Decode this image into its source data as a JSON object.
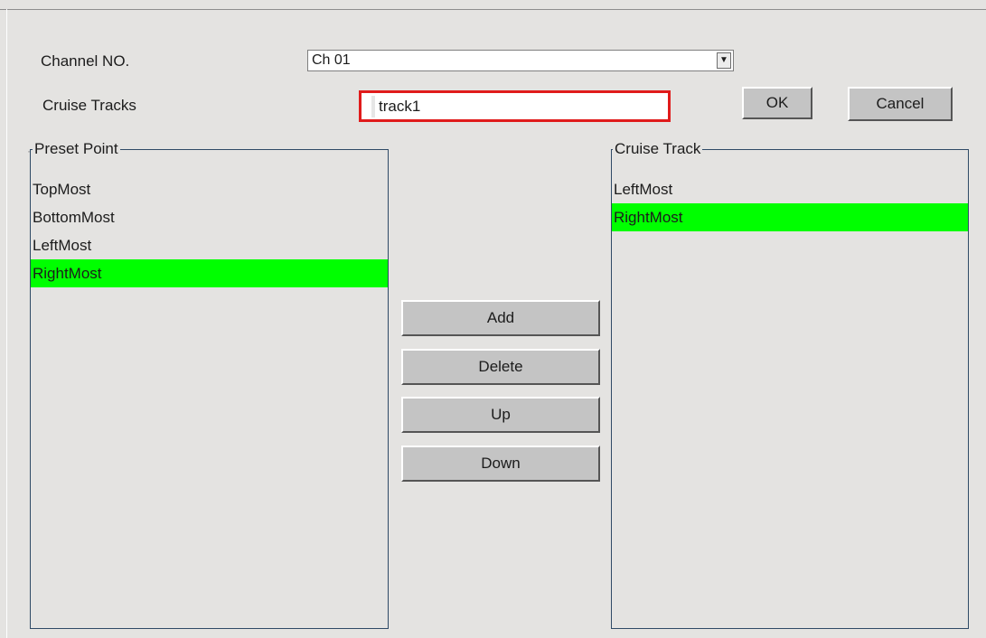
{
  "channel": {
    "label": "Channel NO.",
    "selected": "Ch 01",
    "dropdown_icon": "triangle-down"
  },
  "cruise": {
    "label": "Cruise Tracks",
    "value": "track1"
  },
  "buttons": {
    "ok": "OK",
    "cancel": "Cancel",
    "add": "Add",
    "delete": "Delete",
    "up": "Up",
    "down": "Down"
  },
  "preset_list": {
    "title": "Preset Point",
    "items": [
      "TopMost",
      "BottomMost",
      "LeftMost",
      "RightMost"
    ],
    "selected_index": 3
  },
  "track_list": {
    "title": "Cruise Track",
    "items": [
      "LeftMost",
      "RightMost"
    ],
    "selected_index": 1
  },
  "colors": {
    "selection": "#00ff00",
    "focus_border": "#e01b1b",
    "background": "#e4e3e1"
  }
}
